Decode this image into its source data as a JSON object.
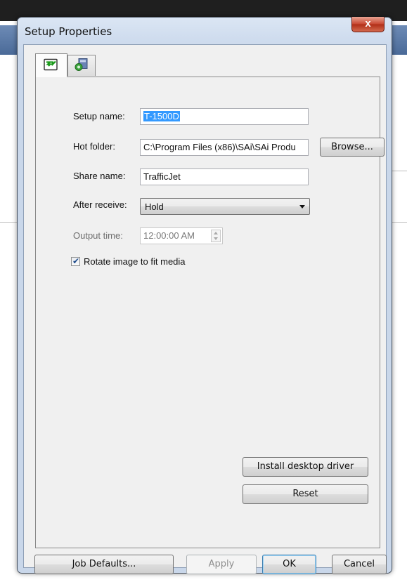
{
  "window": {
    "title": "Setup Properties",
    "close_glyph": "x"
  },
  "tabs": [
    {
      "icon": "folder-arrow-icon",
      "active": true
    },
    {
      "icon": "printer-settings-icon",
      "active": false
    }
  ],
  "form": {
    "setup_name_label": "Setup name:",
    "setup_name_value": "T-1500D",
    "hot_folder_label": "Hot folder:",
    "hot_folder_value": "C:\\Program Files (x86)\\SAi\\SAi Produ",
    "browse_label": "Browse...",
    "share_name_label": "Share name:",
    "share_name_value": "TrafficJet",
    "after_receive_label": "After receive:",
    "after_receive_value": "Hold",
    "output_time_label": "Output time:",
    "output_time_value": "12:00:00 AM",
    "rotate_label": "Rotate image to fit media",
    "rotate_checked": true
  },
  "panel_buttons": {
    "install_driver": "Install desktop driver",
    "reset": "Reset"
  },
  "footer": {
    "job_defaults": "Job Defaults...",
    "apply": "Apply",
    "ok": "OK",
    "cancel": "Cancel"
  },
  "colors": {
    "selection": "#3399ff",
    "close_button": "#c8452f"
  }
}
